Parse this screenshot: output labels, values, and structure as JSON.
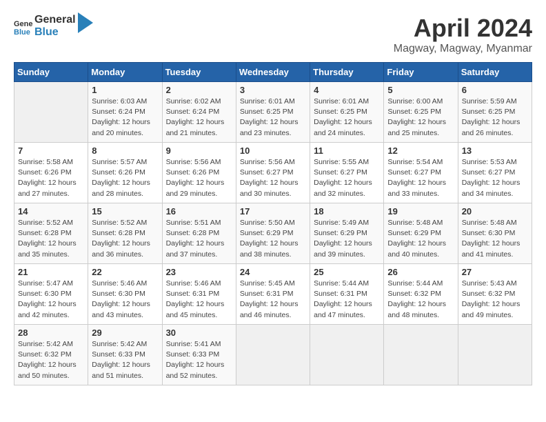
{
  "header": {
    "logo_general": "General",
    "logo_blue": "Blue",
    "month": "April 2024",
    "location": "Magway, Magway, Myanmar"
  },
  "days_of_week": [
    "Sunday",
    "Monday",
    "Tuesday",
    "Wednesday",
    "Thursday",
    "Friday",
    "Saturday"
  ],
  "weeks": [
    [
      {
        "day": "",
        "info": ""
      },
      {
        "day": "1",
        "info": "Sunrise: 6:03 AM\nSunset: 6:24 PM\nDaylight: 12 hours\nand 20 minutes."
      },
      {
        "day": "2",
        "info": "Sunrise: 6:02 AM\nSunset: 6:24 PM\nDaylight: 12 hours\nand 21 minutes."
      },
      {
        "day": "3",
        "info": "Sunrise: 6:01 AM\nSunset: 6:25 PM\nDaylight: 12 hours\nand 23 minutes."
      },
      {
        "day": "4",
        "info": "Sunrise: 6:01 AM\nSunset: 6:25 PM\nDaylight: 12 hours\nand 24 minutes."
      },
      {
        "day": "5",
        "info": "Sunrise: 6:00 AM\nSunset: 6:25 PM\nDaylight: 12 hours\nand 25 minutes."
      },
      {
        "day": "6",
        "info": "Sunrise: 5:59 AM\nSunset: 6:25 PM\nDaylight: 12 hours\nand 26 minutes."
      }
    ],
    [
      {
        "day": "7",
        "info": "Sunrise: 5:58 AM\nSunset: 6:26 PM\nDaylight: 12 hours\nand 27 minutes."
      },
      {
        "day": "8",
        "info": "Sunrise: 5:57 AM\nSunset: 6:26 PM\nDaylight: 12 hours\nand 28 minutes."
      },
      {
        "day": "9",
        "info": "Sunrise: 5:56 AM\nSunset: 6:26 PM\nDaylight: 12 hours\nand 29 minutes."
      },
      {
        "day": "10",
        "info": "Sunrise: 5:56 AM\nSunset: 6:27 PM\nDaylight: 12 hours\nand 30 minutes."
      },
      {
        "day": "11",
        "info": "Sunrise: 5:55 AM\nSunset: 6:27 PM\nDaylight: 12 hours\nand 32 minutes."
      },
      {
        "day": "12",
        "info": "Sunrise: 5:54 AM\nSunset: 6:27 PM\nDaylight: 12 hours\nand 33 minutes."
      },
      {
        "day": "13",
        "info": "Sunrise: 5:53 AM\nSunset: 6:27 PM\nDaylight: 12 hours\nand 34 minutes."
      }
    ],
    [
      {
        "day": "14",
        "info": "Sunrise: 5:52 AM\nSunset: 6:28 PM\nDaylight: 12 hours\nand 35 minutes."
      },
      {
        "day": "15",
        "info": "Sunrise: 5:52 AM\nSunset: 6:28 PM\nDaylight: 12 hours\nand 36 minutes."
      },
      {
        "day": "16",
        "info": "Sunrise: 5:51 AM\nSunset: 6:28 PM\nDaylight: 12 hours\nand 37 minutes."
      },
      {
        "day": "17",
        "info": "Sunrise: 5:50 AM\nSunset: 6:29 PM\nDaylight: 12 hours\nand 38 minutes."
      },
      {
        "day": "18",
        "info": "Sunrise: 5:49 AM\nSunset: 6:29 PM\nDaylight: 12 hours\nand 39 minutes."
      },
      {
        "day": "19",
        "info": "Sunrise: 5:48 AM\nSunset: 6:29 PM\nDaylight: 12 hours\nand 40 minutes."
      },
      {
        "day": "20",
        "info": "Sunrise: 5:48 AM\nSunset: 6:30 PM\nDaylight: 12 hours\nand 41 minutes."
      }
    ],
    [
      {
        "day": "21",
        "info": "Sunrise: 5:47 AM\nSunset: 6:30 PM\nDaylight: 12 hours\nand 42 minutes."
      },
      {
        "day": "22",
        "info": "Sunrise: 5:46 AM\nSunset: 6:30 PM\nDaylight: 12 hours\nand 43 minutes."
      },
      {
        "day": "23",
        "info": "Sunrise: 5:46 AM\nSunset: 6:31 PM\nDaylight: 12 hours\nand 45 minutes."
      },
      {
        "day": "24",
        "info": "Sunrise: 5:45 AM\nSunset: 6:31 PM\nDaylight: 12 hours\nand 46 minutes."
      },
      {
        "day": "25",
        "info": "Sunrise: 5:44 AM\nSunset: 6:31 PM\nDaylight: 12 hours\nand 47 minutes."
      },
      {
        "day": "26",
        "info": "Sunrise: 5:44 AM\nSunset: 6:32 PM\nDaylight: 12 hours\nand 48 minutes."
      },
      {
        "day": "27",
        "info": "Sunrise: 5:43 AM\nSunset: 6:32 PM\nDaylight: 12 hours\nand 49 minutes."
      }
    ],
    [
      {
        "day": "28",
        "info": "Sunrise: 5:42 AM\nSunset: 6:32 PM\nDaylight: 12 hours\nand 50 minutes."
      },
      {
        "day": "29",
        "info": "Sunrise: 5:42 AM\nSunset: 6:33 PM\nDaylight: 12 hours\nand 51 minutes."
      },
      {
        "day": "30",
        "info": "Sunrise: 5:41 AM\nSunset: 6:33 PM\nDaylight: 12 hours\nand 52 minutes."
      },
      {
        "day": "",
        "info": ""
      },
      {
        "day": "",
        "info": ""
      },
      {
        "day": "",
        "info": ""
      },
      {
        "day": "",
        "info": ""
      }
    ]
  ]
}
